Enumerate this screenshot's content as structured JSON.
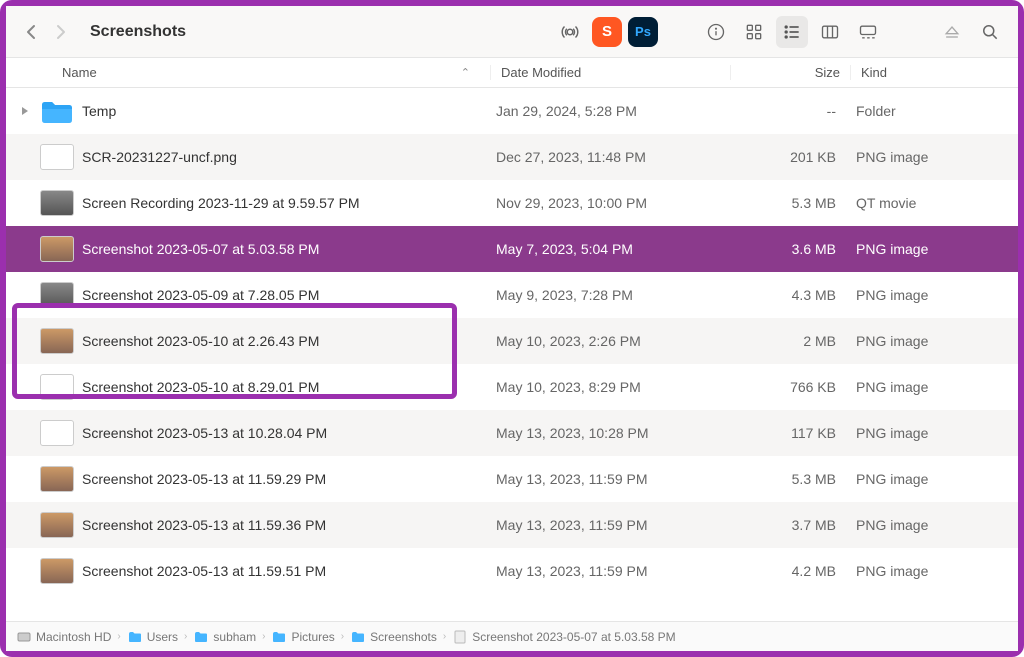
{
  "title": "Screenshots",
  "columns": {
    "name": "Name",
    "date": "Date Modified",
    "size": "Size",
    "kind": "Kind"
  },
  "rows": [
    {
      "name": "Temp",
      "date": "Jan 29, 2024, 5:28 PM",
      "size": "--",
      "kind": "Folder",
      "icon": "folder",
      "disclosure": true
    },
    {
      "name": "SCR-20231227-uncf.png",
      "date": "Dec 27, 2023, 11:48 PM",
      "size": "201 KB",
      "kind": "PNG image",
      "icon": "doc"
    },
    {
      "name": "Screen Recording 2023-11-29 at 9.59.57 PM",
      "date": "Nov 29, 2023, 10:00 PM",
      "size": "5.3 MB",
      "kind": "QT movie",
      "icon": "dark"
    },
    {
      "name": "Screenshot 2023-05-07 at 5.03.58 PM",
      "date": "May 7, 2023, 5:04 PM",
      "size": "3.6 MB",
      "kind": "PNG image",
      "icon": "photo",
      "selected": true
    },
    {
      "name": "Screenshot 2023-05-09 at 7.28.05 PM",
      "date": "May 9, 2023, 7:28 PM",
      "size": "4.3 MB",
      "kind": "PNG image",
      "icon": "dark"
    },
    {
      "name": "Screenshot 2023-05-10 at 2.26.43 PM",
      "date": "May 10, 2023, 2:26 PM",
      "size": "2 MB",
      "kind": "PNG image",
      "icon": "photo"
    },
    {
      "name": "Screenshot 2023-05-10 at 8.29.01 PM",
      "date": "May 10, 2023, 8:29 PM",
      "size": "766 KB",
      "kind": "PNG image",
      "icon": "doc"
    },
    {
      "name": "Screenshot 2023-05-13 at 10.28.04 PM",
      "date": "May 13, 2023, 10:28 PM",
      "size": "117 KB",
      "kind": "PNG image",
      "icon": "doc"
    },
    {
      "name": "Screenshot 2023-05-13 at 11.59.29 PM",
      "date": "May 13, 2023, 11:59 PM",
      "size": "5.3 MB",
      "kind": "PNG image",
      "icon": "photo"
    },
    {
      "name": "Screenshot 2023-05-13 at 11.59.36 PM",
      "date": "May 13, 2023, 11:59 PM",
      "size": "3.7 MB",
      "kind": "PNG image",
      "icon": "photo"
    },
    {
      "name": "Screenshot 2023-05-13 at 11.59.51 PM",
      "date": "May 13, 2023, 11:59 PM",
      "size": "4.2 MB",
      "kind": "PNG image",
      "icon": "photo"
    }
  ],
  "path": [
    {
      "label": "Macintosh HD",
      "icon": "disk"
    },
    {
      "label": "Users",
      "icon": "folder"
    },
    {
      "label": "subham",
      "icon": "folder"
    },
    {
      "label": "Pictures",
      "icon": "folder"
    },
    {
      "label": "Screenshots",
      "icon": "folder"
    },
    {
      "label": "Screenshot 2023-05-07 at 5.03.58 PM",
      "icon": "file"
    }
  ]
}
